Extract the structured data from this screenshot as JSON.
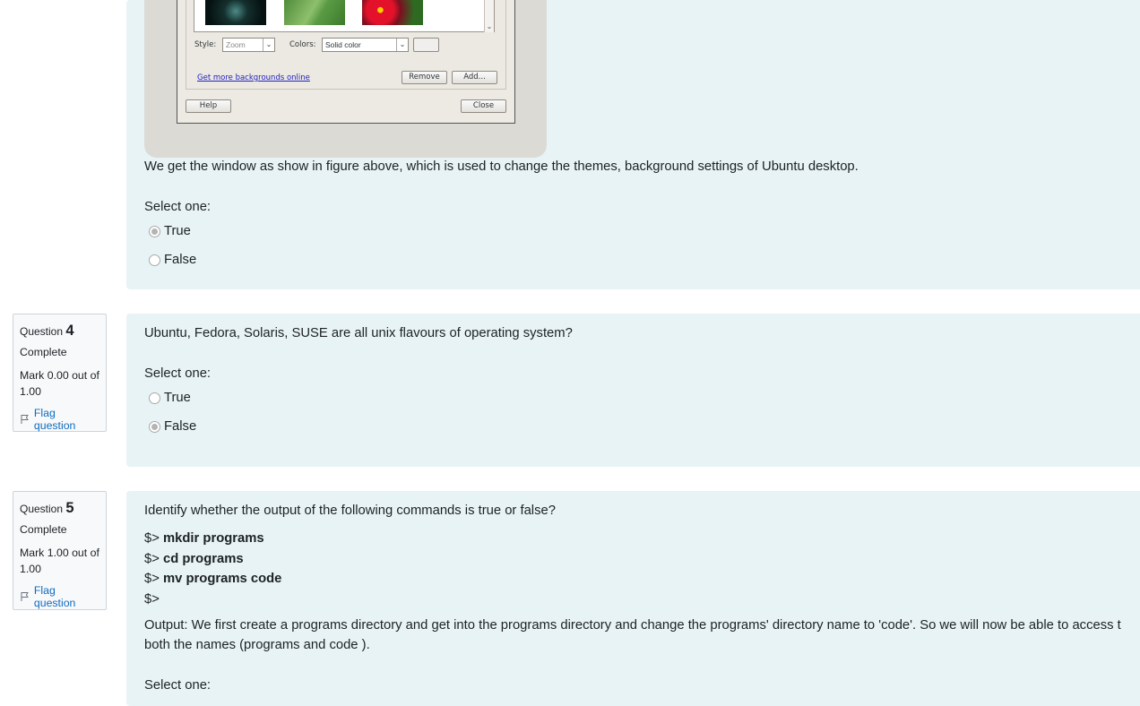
{
  "q3": {
    "image": {
      "style_label": "Style:",
      "style_value": "Zoom",
      "colors_label": "Colors:",
      "colors_value": "Solid color",
      "more_link": "Get more backgrounds online",
      "remove_label": "Remove",
      "add_label": "Add...",
      "help_label": "Help",
      "close_label": "Close"
    },
    "text": "We get the window as show in figure above, which is used to change the themes, background settings of Ubuntu desktop.",
    "prompt": "Select one:",
    "options": [
      {
        "label": "True",
        "selected": true
      },
      {
        "label": "False",
        "selected": false
      }
    ]
  },
  "q4": {
    "info": {
      "label": "Question",
      "number": "4",
      "state": "Complete",
      "grade": "Mark 0.00 out of 1.00",
      "flag": "Flag question"
    },
    "text": "Ubuntu, Fedora, Solaris, SUSE are all unix flavours of operating system?",
    "prompt": "Select one:",
    "options": [
      {
        "label": "True",
        "selected": false
      },
      {
        "label": "False",
        "selected": true
      }
    ]
  },
  "q5": {
    "info": {
      "label": "Question",
      "number": "5",
      "state": "Complete",
      "grade": "Mark 1.00 out of 1.00",
      "flag": "Flag question"
    },
    "text": "Identify whether the output of the following commands is true or false?",
    "commands": [
      {
        "prompt": "$>",
        "cmd": "mkdir programs"
      },
      {
        "prompt": "$>",
        "cmd": "cd programs"
      },
      {
        "prompt": "$>",
        "cmd": "mv programs code"
      },
      {
        "prompt": "$>",
        "cmd": ""
      }
    ],
    "output_line1": "Output: We first create a programs directory and get into the programs directory and change the programs' directory name  to 'code'. So we will now be able to access t",
    "output_line2": "both the names (programs and code ).",
    "prompt": "Select one:"
  }
}
